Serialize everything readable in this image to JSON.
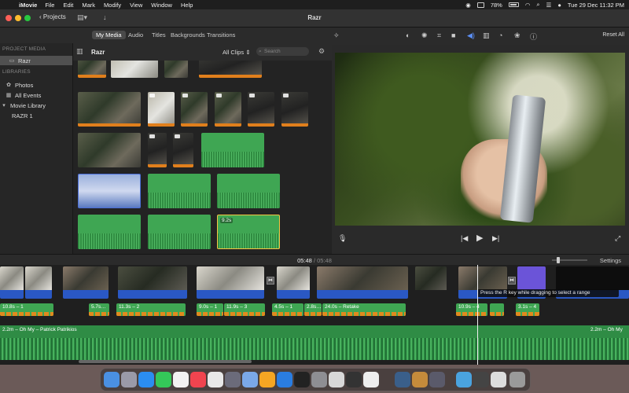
{
  "menubar": {
    "app": "iMovie",
    "items": [
      "File",
      "Edit",
      "Mark",
      "Modify",
      "View",
      "Window",
      "Help"
    ],
    "battery": "78%",
    "datetime": "Tue 29 Dec  11:32 PM"
  },
  "toolbar": {
    "projects_label": "Projects",
    "window_title": "Razr"
  },
  "browser_tabs": [
    "My Media",
    "Audio",
    "Titles",
    "Backgrounds",
    "Transitions"
  ],
  "sidebar": {
    "project_media_header": "PROJECT MEDIA",
    "project": "Razr",
    "libraries_header": "LIBRARIES",
    "photos": "Photos",
    "all_events": "All Events",
    "movie_library": "Movie Library",
    "event": "RAZR 1"
  },
  "browser": {
    "title": "Razr",
    "filter": "All Clips",
    "search_placeholder": "Search",
    "selected_clip_duration": "9.2s"
  },
  "viewer": {
    "reset_all": "Reset All"
  },
  "timeline": {
    "playhead_time": "05:48",
    "total_time": "05:48",
    "settings_label": "Settings",
    "tooltip": "Press the R key while dragging to select a range",
    "audio_clips": [
      "10.8s – 1",
      "5.7s…",
      "11.3s – 2",
      "9.0s – 1",
      "11.9s – 3",
      "4.5s – 1",
      "2.8s…",
      "24.0s – Retake",
      "10.9s – 4",
      "3.1s – 4"
    ],
    "music_label": "2.2m – Oh My – Patrick Patrikios",
    "music_label_end": "2.2m – Oh My"
  },
  "colors": {
    "audio_green": "#3fa653",
    "video_audio_blue": "#2a58c4",
    "selection_yellow": "#f5c542",
    "accent_blue": "#4b6fd8"
  }
}
